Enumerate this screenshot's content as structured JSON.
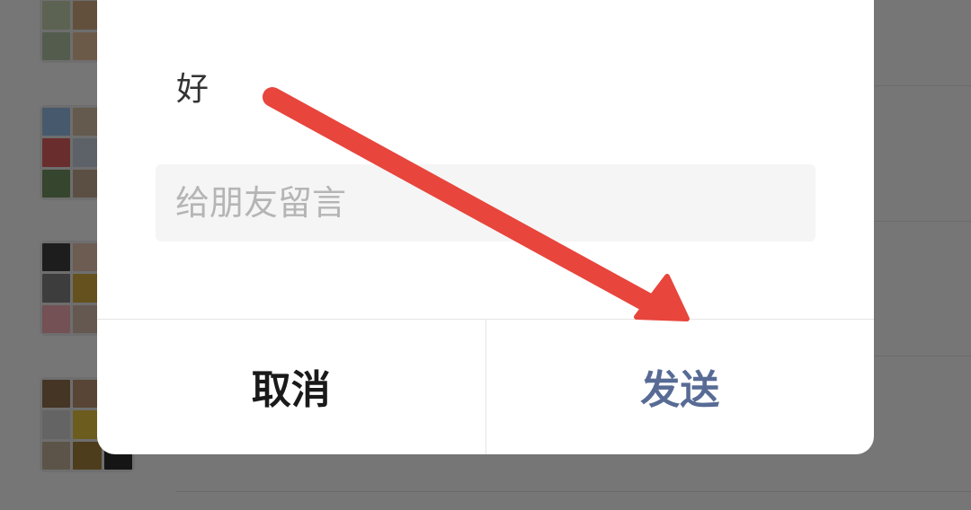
{
  "dialog": {
    "preview_text": "好",
    "message_input": {
      "value": "",
      "placeholder": "给朋友留言"
    },
    "cancel_label": "取消",
    "send_label": "发送"
  },
  "colors": {
    "send_accent": "#576b95",
    "annotation_arrow": "#e8453c",
    "overlay": "rgba(0,0,0,0.5)"
  },
  "annotation": {
    "type": "arrow",
    "points_to": "send-button"
  }
}
